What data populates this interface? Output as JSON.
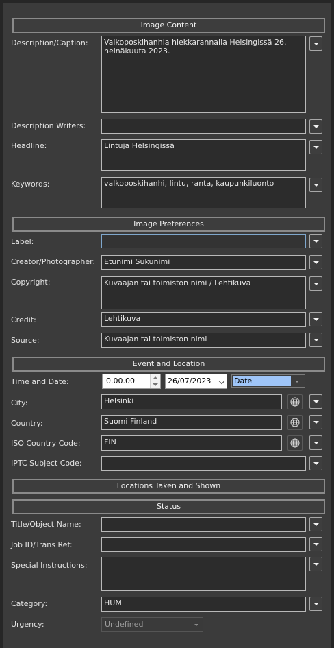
{
  "sections": {
    "image_content": "Image Content",
    "image_preferences": "Image Preferences",
    "event_location": "Event and Location",
    "locations_taken": "Locations Taken and Shown",
    "status": "Status"
  },
  "image_content": {
    "description_label": "Description/Caption:",
    "description_value": "Valkoposkihanhia hiekkarannalla Helsingissä 26. heinäkuuta 2023.",
    "description_writers_label": "Description Writers:",
    "description_writers_value": "",
    "headline_label": "Headline:",
    "headline_value": "Lintuja Helsingissä",
    "keywords_label": "Keywords:",
    "keywords_value": "valkoposkihanhi, lintu, ranta, kaupunkiluonto"
  },
  "image_preferences": {
    "label_label": "Label:",
    "label_value": "",
    "creator_label": "Creator/Photographer:",
    "creator_value": "Etunimi Sukunimi",
    "copyright_label": "Copyright:",
    "copyright_value": "Kuvaajan tai toimiston nimi / Lehtikuva",
    "credit_label": "Credit:",
    "credit_value": "Lehtikuva",
    "source_label": "Source:",
    "source_value": "Kuvaajan tai toimiston nimi"
  },
  "event_location": {
    "time_date_label": "Time and Date:",
    "time_value": "0.00.00",
    "date_value": "26/07/2023",
    "date_type": "Date",
    "city_label": "City:",
    "city_value": "Helsinki",
    "country_label": "Country:",
    "country_value": "Suomi Finland",
    "iso_label": "ISO Country Code:",
    "iso_value": "FIN",
    "iptc_label": "IPTC Subject Code:",
    "iptc_value": ""
  },
  "status": {
    "title_label": "Title/Object Name:",
    "title_value": "",
    "job_label": "Job ID/Trans Ref:",
    "job_value": "",
    "instructions_label": "Special Instructions:",
    "instructions_value": "",
    "category_label": "Category:",
    "category_value": "HUM",
    "urgency_label": "Urgency:",
    "urgency_value": "Undefined"
  },
  "icons": {
    "dropdown": "chevron-down-icon",
    "globe": "globe-icon"
  }
}
